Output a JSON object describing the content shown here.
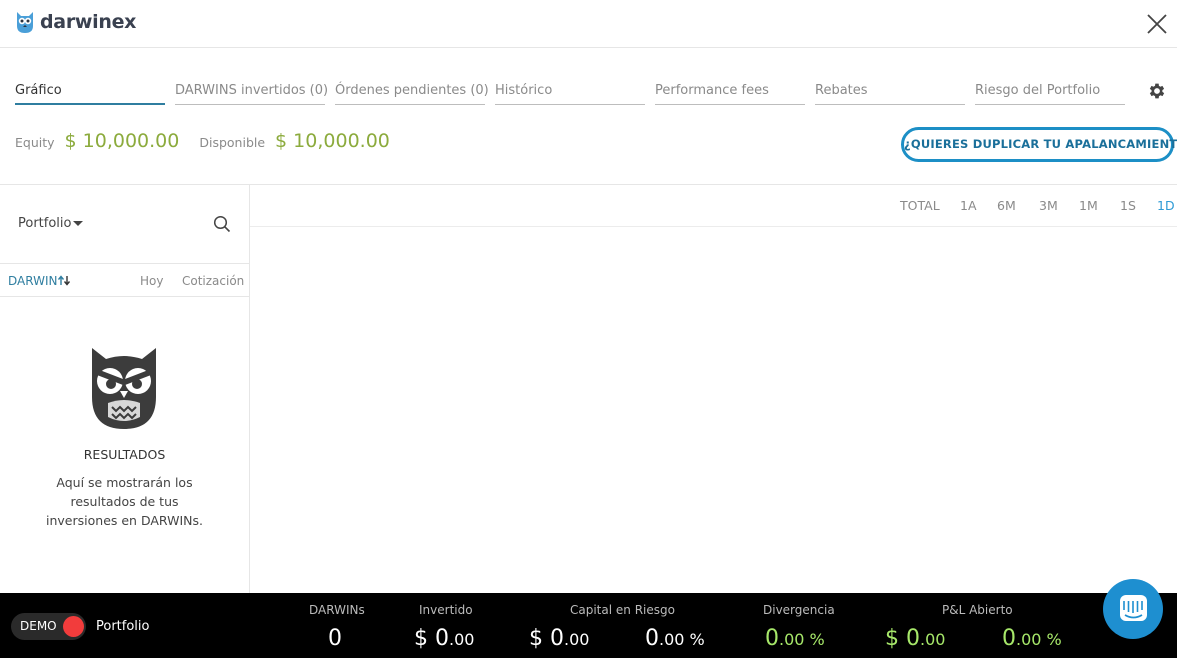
{
  "header": {
    "logo_text": "darwinex"
  },
  "tabs": [
    {
      "label": "Gráfico"
    },
    {
      "label": "DARWINS invertidos (0)"
    },
    {
      "label": "Órdenes pendientes (0)"
    },
    {
      "label": "Histórico"
    },
    {
      "label": "Performance fees"
    },
    {
      "label": "Rebates"
    },
    {
      "label": "Riesgo del Portfolio"
    }
  ],
  "equity": {
    "label": "Equity",
    "value": "$ 10,000.00"
  },
  "available": {
    "label": "Disponible",
    "value": "$ 10,000.00"
  },
  "leverage_cta": "¿QUIERES DUPLICAR TU APALANCAMIENTO?",
  "sidebar": {
    "dropdown": "Portfolio",
    "columns": {
      "darwin": "DARWIN",
      "today": "Hoy",
      "quote": "Cotización"
    },
    "empty_title": "RESULTADOS",
    "empty_text": "Aquí se mostrarán los resultados de tus inversiones en DARWINs."
  },
  "periods": [
    "TOTAL",
    "1A",
    "6M",
    "3M",
    "1M",
    "1S",
    "1D"
  ],
  "footer": {
    "mode": "DEMO",
    "portfolio": "Portfolio",
    "stats": {
      "darwins": {
        "label": "DARWINs",
        "value": "0"
      },
      "invested": {
        "label": "Invertido",
        "prefix": "$ 0",
        "decimals": ".00"
      },
      "capital_risk": {
        "label": "Capital en Riesgo",
        "prefix": "$ 0",
        "decimals": ".00",
        "pct_main": "0",
        "pct_dec": ".00 %"
      },
      "divergence": {
        "label": "Divergencia",
        "main": "0",
        "dec": ".00 %"
      },
      "pnl": {
        "label": "P&L Abierto",
        "prefix": "$ 0",
        "decimals": ".00",
        "pct_main": "0",
        "pct_dec": ".00 %"
      }
    }
  },
  "colors": {
    "accent": "#2f7ea0",
    "green": "#8cab3d",
    "footer_green": "#a7e86a",
    "toggle_red": "#f23c3c"
  }
}
